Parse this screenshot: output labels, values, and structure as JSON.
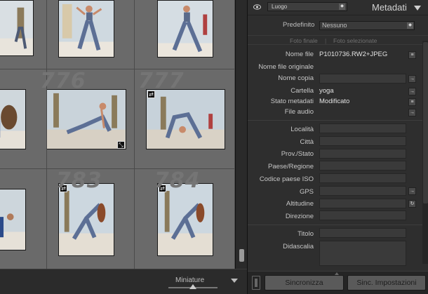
{
  "grid": {
    "cell_numbers": [
      "776",
      "777",
      "783",
      "784"
    ],
    "thumb_size_label": "Miniature"
  },
  "panel": {
    "preset_dropdown": "Luogo",
    "title": "Metadati",
    "preset_label": "Predefinito",
    "preset_value": "Nessuno",
    "tab_final": "Foto finale",
    "tab_selected": "Foto selezionate",
    "fields": {
      "file_name_label": "Nome file",
      "file_name_value": "P1010736.RW2+JPEG",
      "original_name_label": "Nome file originale",
      "copy_name_label": "Nome copia",
      "folder_label": "Cartella",
      "folder_value": "yoga",
      "status_label": "Stato metadati",
      "status_value": "Modificato",
      "audio_label": "File audio",
      "location_label": "Località",
      "city_label": "Città",
      "state_label": "Prov./Stato",
      "country_label": "Paese/Regione",
      "iso_label": "Codice paese ISO",
      "gps_label": "GPS",
      "altitude_label": "Altitudine",
      "direction_label": "Direzione",
      "title_label": "Titolo",
      "caption_label": "Didascalia"
    },
    "buttons": {
      "sync": "Sincronizza",
      "sync_settings": "Sinc. Impostazioni"
    }
  },
  "icons": {
    "visibility": "eye-icon",
    "collapse": "triangle-down-icon",
    "swap": "swap-arrows-icon",
    "crop": "crop-icon",
    "jump": "arrow-right-icon",
    "list": "list-icon",
    "gps_refresh": "refresh-icon"
  },
  "colors": {
    "panel_bg": "#2e2e2e",
    "grid_bg": "#5f5f5f",
    "button_bg": "#5a5a5a"
  }
}
